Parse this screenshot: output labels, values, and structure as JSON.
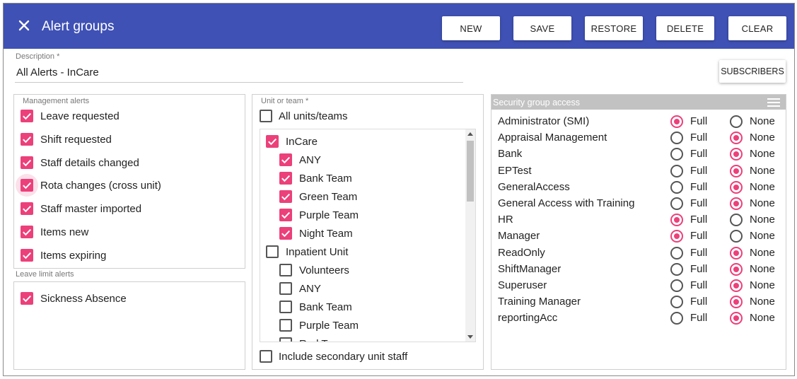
{
  "header": {
    "title": "Alert groups",
    "buttons": {
      "new": "NEW",
      "save": "SAVE",
      "restore": "RESTORE",
      "delete": "DELETE",
      "clear": "CLEAR"
    },
    "color": "#3f51b5"
  },
  "description": {
    "label": "Description *",
    "value": "All Alerts - InCare"
  },
  "subscribers_label": "SUBSCRIBERS",
  "management_alerts": {
    "label": "Management alerts",
    "items": [
      {
        "label": "Leave requested",
        "checked": true
      },
      {
        "label": "Shift requested",
        "checked": true
      },
      {
        "label": "Staff details changed",
        "checked": true
      },
      {
        "label": "Rota changes (cross unit)",
        "checked": true
      },
      {
        "label": "Staff master imported",
        "checked": true
      },
      {
        "label": "Items new",
        "checked": true
      },
      {
        "label": "Items expiring",
        "checked": true
      }
    ]
  },
  "leave_limit_alerts": {
    "label": "Leave limit alerts",
    "items": [
      {
        "label": "Sickness Absence",
        "checked": true
      }
    ]
  },
  "units": {
    "label": "Unit or team *",
    "all_label": "All units/teams",
    "all_checked": false,
    "tree": [
      {
        "label": "InCare",
        "checked": true,
        "level": 0
      },
      {
        "label": "ANY",
        "checked": true,
        "level": 1
      },
      {
        "label": "Bank Team",
        "checked": true,
        "level": 1
      },
      {
        "label": "Green Team",
        "checked": true,
        "level": 1
      },
      {
        "label": "Purple Team",
        "checked": true,
        "level": 1
      },
      {
        "label": "Night Team",
        "checked": true,
        "level": 1
      },
      {
        "label": "Inpatient Unit",
        "checked": false,
        "level": 0
      },
      {
        "label": "Volunteers",
        "checked": false,
        "level": 1
      },
      {
        "label": "ANY",
        "checked": false,
        "level": 1
      },
      {
        "label": "Bank Team",
        "checked": false,
        "level": 1
      },
      {
        "label": "Purple Team",
        "checked": false,
        "level": 1
      },
      {
        "label": "Red Team",
        "checked": false,
        "level": 1
      }
    ],
    "secondary_label": "Include secondary unit staff",
    "secondary_checked": false
  },
  "security": {
    "label": "Security group access",
    "full_label": "Full",
    "none_label": "None",
    "groups": [
      {
        "name": "Administrator (SMI)",
        "access": "Full"
      },
      {
        "name": "Appraisal Management",
        "access": "None"
      },
      {
        "name": "Bank",
        "access": "None"
      },
      {
        "name": "EPTest",
        "access": "None"
      },
      {
        "name": "GeneralAccess",
        "access": "None"
      },
      {
        "name": "General Access with Training",
        "access": "None"
      },
      {
        "name": "HR",
        "access": "Full"
      },
      {
        "name": "Manager",
        "access": "Full"
      },
      {
        "name": "ReadOnly",
        "access": "None"
      },
      {
        "name": "ShiftManager",
        "access": "None"
      },
      {
        "name": "Superuser",
        "access": "None"
      },
      {
        "name": "Training Manager",
        "access": "None"
      },
      {
        "name": "reportingAcc",
        "access": "None"
      }
    ]
  },
  "accent": "#ec407a"
}
